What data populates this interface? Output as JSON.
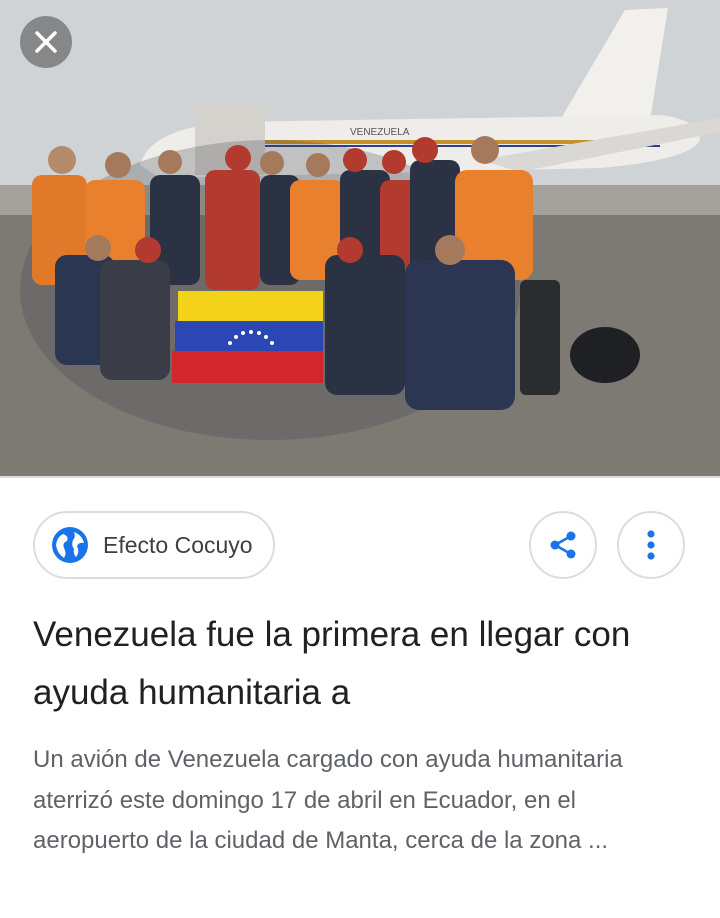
{
  "image": {
    "description_icon": "photo",
    "close_icon": "close-icon",
    "plane_text": "VENEZUELA"
  },
  "source": {
    "name": "Efecto Cocuyo",
    "icon": "globe-icon"
  },
  "actions": {
    "share_icon": "share-icon",
    "more_icon": "more-vert-icon"
  },
  "article": {
    "title": "Venezuela fue la primera en llegar con ayuda humanitaria a",
    "snippet": "Un avión de Venezuela cargado con ayuda humanitaria aterrizó este domingo 17 de abril en Ecuador, en el aeropuerto de la ciudad de Manta, cerca de la zona ..."
  },
  "colors": {
    "accent": "#1a73e8",
    "title": "#202124",
    "snippet": "#5f6368",
    "border": "#dadce0"
  }
}
